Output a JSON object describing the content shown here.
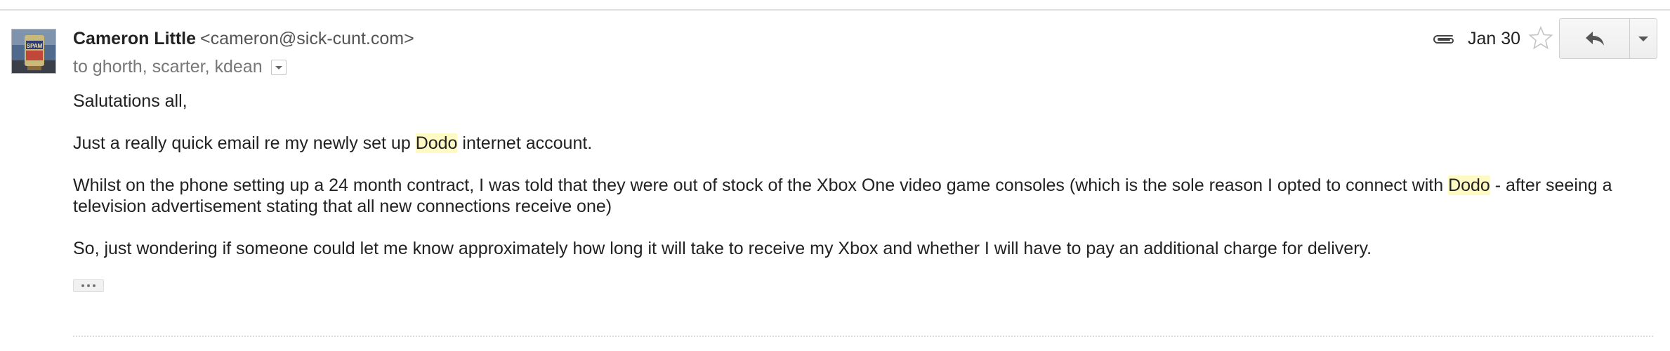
{
  "message": {
    "sender": {
      "name": "Cameron Little",
      "email": "<cameron@sick-cunt.com>",
      "avatar_icon": "spam-can-avatar"
    },
    "recipients": "to ghorth, scarter, kdean",
    "date": "Jan 30",
    "has_attachment": true,
    "attachment_icon": "paperclip-icon",
    "actions": {
      "reply_icon": "reply-icon",
      "more_icon": "chevron-down-icon",
      "star_icon": "star-icon"
    },
    "body": {
      "greeting": "Salutations all,",
      "p1": {
        "before": "Just a really quick email re my newly set up ",
        "highlight": "Dodo",
        "after": " internet account."
      },
      "p2": {
        "before": "Whilst on the phone setting up a 24 month contract, I was told that they were out of stock of the Xbox One video game consoles (which is the sole reason I opted to connect with ",
        "highlight": "Dodo",
        "after": " - after seeing a television advertisement stating that all new connections receive one)"
      },
      "p3": "So, just wondering if someone could let me know approximately how long it will take to receive my Xbox and whether I will have to pay an additional charge for delivery."
    },
    "trimmed_content_icon": "ellipsis-icon"
  },
  "colors": {
    "highlight": "#fff9c4",
    "divider": "#dedede",
    "text": "#222222",
    "muted": "#777777"
  }
}
